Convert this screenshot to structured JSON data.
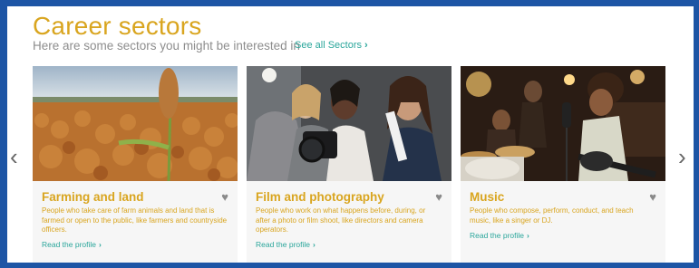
{
  "header": {
    "title": "Career sectors",
    "subtitle": "Here are some sectors you might be interested in",
    "see_all_label": "See all Sectors",
    "see_all_chevron": "›"
  },
  "nav": {
    "prev_arrow": "‹",
    "next_arrow": "›"
  },
  "cards": [
    {
      "title": "Farming and land",
      "description": "People who take care of farm animals and land that is farmed or open to the public, like farmers and countryside officers.",
      "link_label": "Read the profile",
      "link_chevron": "›",
      "favorite_icon": "heart-icon",
      "favorite_glyph": "♥"
    },
    {
      "title": "Film and photography",
      "description": "People who work on what happens before, during, or after a photo or film shoot, like directors and camera operators.",
      "link_label": "Read the profile",
      "link_chevron": "›",
      "favorite_icon": "heart-icon",
      "favorite_glyph": "♥"
    },
    {
      "title": "Music",
      "description": "People who compose, perform, conduct, and teach music, like a singer or DJ.",
      "link_label": "Read the profile",
      "link_chevron": "›",
      "favorite_icon": "heart-icon",
      "favorite_glyph": "♥"
    }
  ],
  "colors": {
    "frame": "#1d55a5",
    "accent_title": "#d9a51f",
    "link": "#2aa69b",
    "card_bg": "#f6f6f6"
  }
}
